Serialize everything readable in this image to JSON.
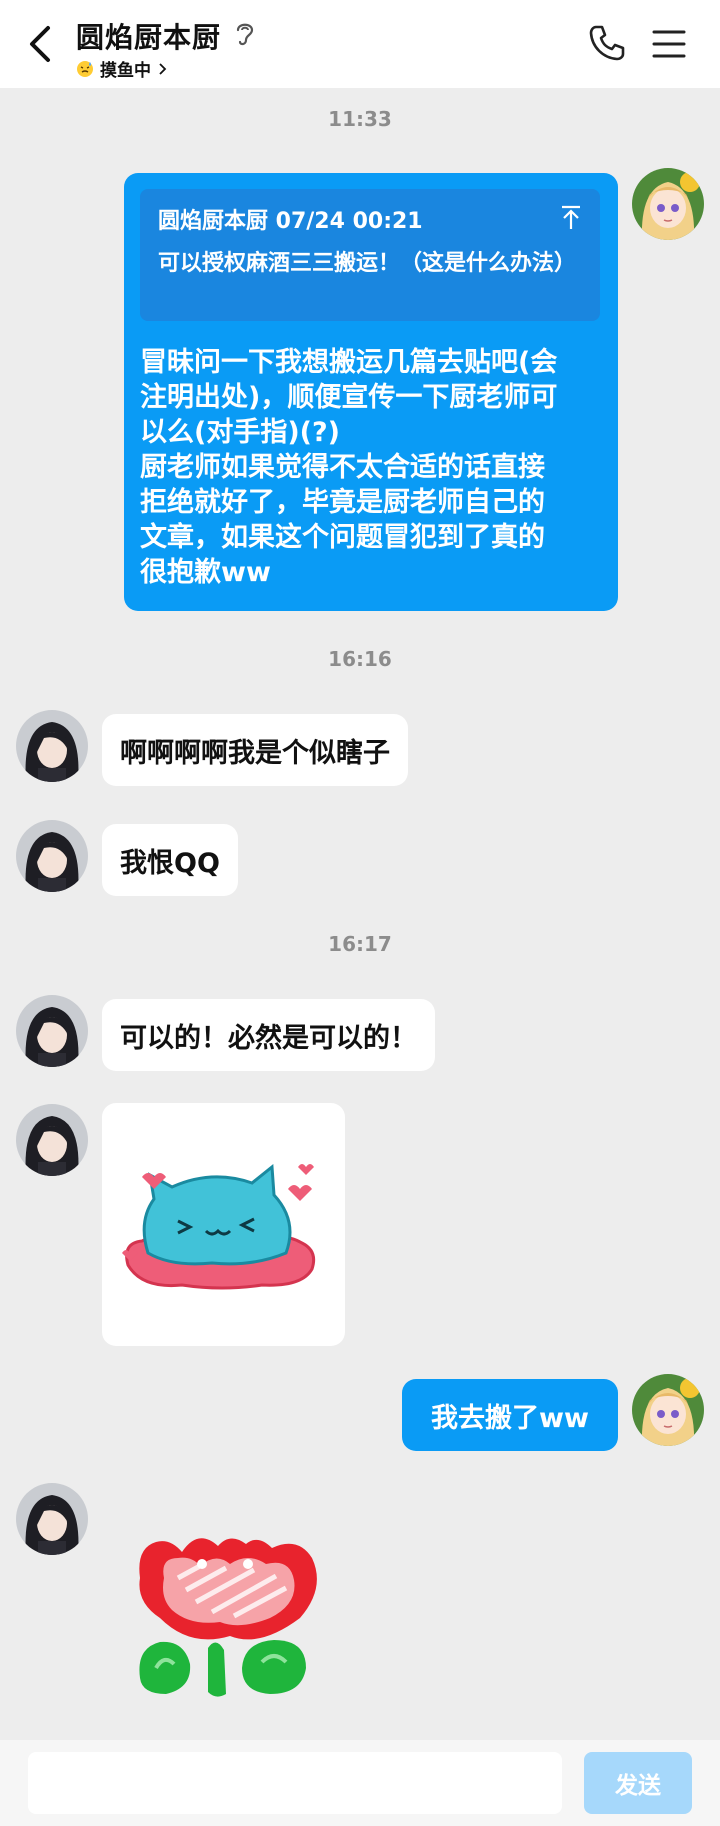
{
  "header": {
    "title": "圆焰厨本厨",
    "status": "摸鱼中"
  },
  "timestamps": [
    "11:33",
    "16:16",
    "16:17"
  ],
  "messages": {
    "out1": {
      "quote_author": "圆焰厨本厨 07/24 00:21",
      "quote_text": "可以授权麻酒三三搬运！（这是什么办法）",
      "text": "冒昧问一下我想搬运几篇去贴吧(会\n注明出处)，顺便宣传一下厨老师可\n以么(对手指)(?)\n厨老师如果觉得不太合适的话直接\n拒绝就好了，毕竟是厨老师自己的\n文章，如果这个问题冒犯到了真的\n很抱歉ww"
    },
    "in1": "啊啊啊啊我是个似瞎子",
    "in2": "我恨QQ",
    "in3": "可以的！必然是可以的！",
    "out2": "我去搬了ww"
  },
  "input": {
    "placeholder": "",
    "send_label": "发送"
  },
  "colors": {
    "out_bubble": "#0a9bf5",
    "quote_bg": "#1a86df",
    "send_disabled": "#a6d8fb",
    "chat_bg": "#ededed"
  },
  "icons": [
    "back-icon",
    "ear-icon",
    "sweat-emoji-icon",
    "chevron-right-icon",
    "phone-icon",
    "menu-icon",
    "pin-icon"
  ]
}
